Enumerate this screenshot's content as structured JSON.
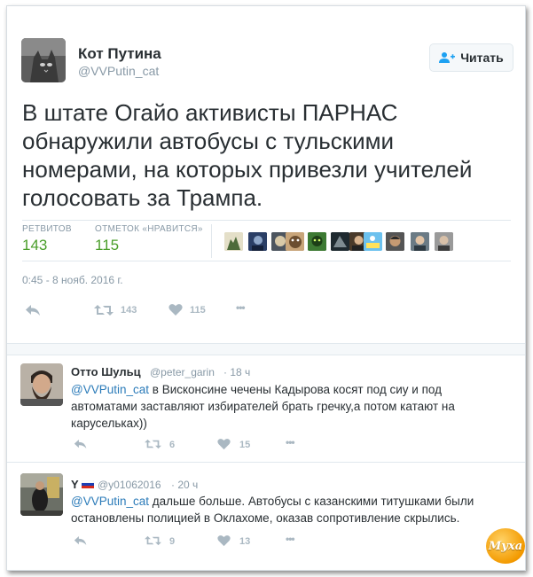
{
  "tweet": {
    "author_name": "Кот Путина",
    "author_handle": "@VVPutin_cat",
    "follow_label": "Читать",
    "text": "В штате Огайо активисты ПАРНАС обнаружили автобусы с тульскими номерами, на которых привезли учителей голосовать за Трампа.",
    "retweets_label": "РЕТВИТОВ",
    "retweets_value": "143",
    "likes_label": "ОТМЕТОК «НРАВИТСЯ»",
    "likes_value": "115",
    "timestamp": "0:45 - 8 нояб. 2016 г.",
    "actions": {
      "retweet_count": "143",
      "like_count": "115",
      "more": "•••"
    }
  },
  "replies": [
    {
      "name": "Отто Шульц",
      "handle": "@peter_garin",
      "time": "· 18 ч",
      "mention": "@VVPutin_cat",
      "text": " в Висконсине чечены Кадырова косят под сиу и под автоматами заставляют избирателей брать гречку,а потом катают на карусельках))",
      "retweet_count": "6",
      "like_count": "15",
      "more": "•••"
    },
    {
      "name": "Y",
      "handle": "@y01062016",
      "time": "· 20 ч",
      "mention": "@VVPutin_cat",
      "text": " дальше больше. Автобусы с казанскими титушками были остановлены полицией в Оклахоме, оказав сопротивление скрылись.",
      "retweet_count": "9",
      "like_count": "13",
      "more": "•••"
    }
  ],
  "watermark": {
    "text": "Муха"
  },
  "colors": {
    "accent_green": "#4a9e2a",
    "mention_blue": "#2b7bb9",
    "muted": "#8899a6"
  },
  "icons": [
    "follow-person-icon",
    "reply-icon",
    "retweet-icon",
    "heart-icon",
    "more-icon",
    "russian-flag-icon"
  ]
}
